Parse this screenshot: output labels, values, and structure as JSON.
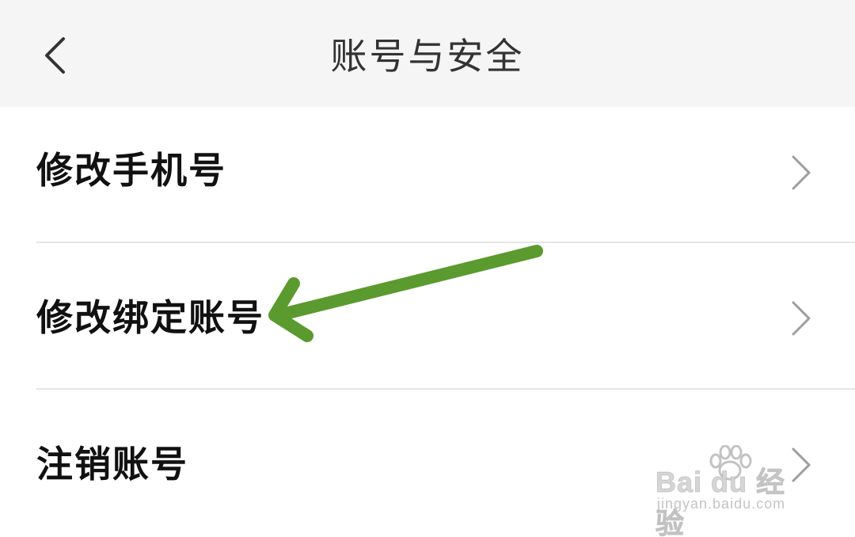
{
  "header": {
    "title": "账号与安全",
    "back_icon": "chevron-left-icon"
  },
  "menu": {
    "items": [
      {
        "label": "修改手机号",
        "icon": "chevron-right-icon"
      },
      {
        "label": "修改绑定账号",
        "icon": "chevron-right-icon"
      },
      {
        "label": "注销账号",
        "icon": "chevron-right-icon"
      }
    ]
  },
  "annotation": {
    "arrow_color": "#5a9a2e",
    "target": "修改绑定账号"
  },
  "watermark": {
    "brand": "Bai du 经验",
    "url": "jingyan.baidu.com"
  },
  "colors": {
    "header_bg": "#f5f5f5",
    "text": "#111111",
    "title": "#333333",
    "chevron": "#9e9e9e",
    "divider": "#e6e6e6"
  }
}
